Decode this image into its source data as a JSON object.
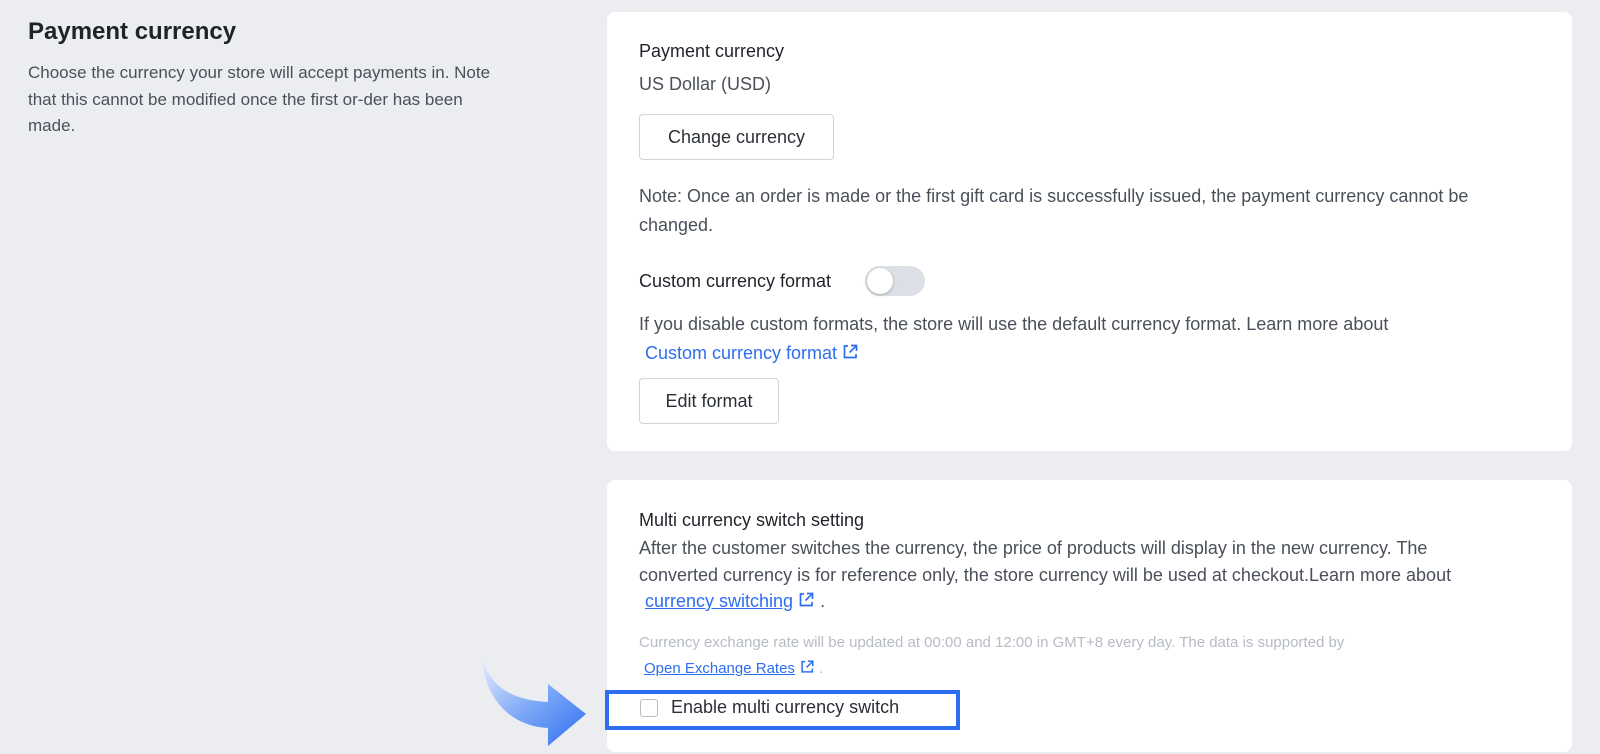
{
  "section": {
    "title": "Payment currency",
    "description": "Choose the currency your store will accept payments in. Note that this cannot be modified once the first or-der has been made."
  },
  "payment_card": {
    "title": "Payment currency",
    "current_value": "US Dollar (USD)",
    "change_button": "Change currency",
    "note": "Note: Once an order is made or the first gift card is successfully issued, the payment currency cannot be changed.",
    "custom_format_label": "Custom currency format",
    "custom_format_enabled": false,
    "custom_format_desc": "If you disable custom formats, the store will use the default currency format. Learn more about",
    "custom_format_link": "Custom currency format",
    "edit_button": "Edit format"
  },
  "multi_card": {
    "title": "Multi currency switch setting",
    "desc_line1": "After the customer switches the currency, the price of products will display in the new currency. The",
    "desc_line2": "converted currency is for reference only, the store currency will be used at checkout.Learn more about",
    "switching_link": "currency switching",
    "period": ".",
    "rate_note": "Currency exchange rate will be updated at 00:00 and 12:00 in GMT+8 every day. The data is supported by",
    "rates_link": "Open Exchange Rates",
    "checkbox_label": "Enable multi currency switch",
    "checkbox_checked": false
  },
  "colors": {
    "accent": "#2d6ef0",
    "background": "#ebedf1",
    "card": "#ffffff"
  },
  "icons": {
    "external_link": "external-link-icon",
    "pointer_arrow": "pointer-arrow-icon"
  }
}
